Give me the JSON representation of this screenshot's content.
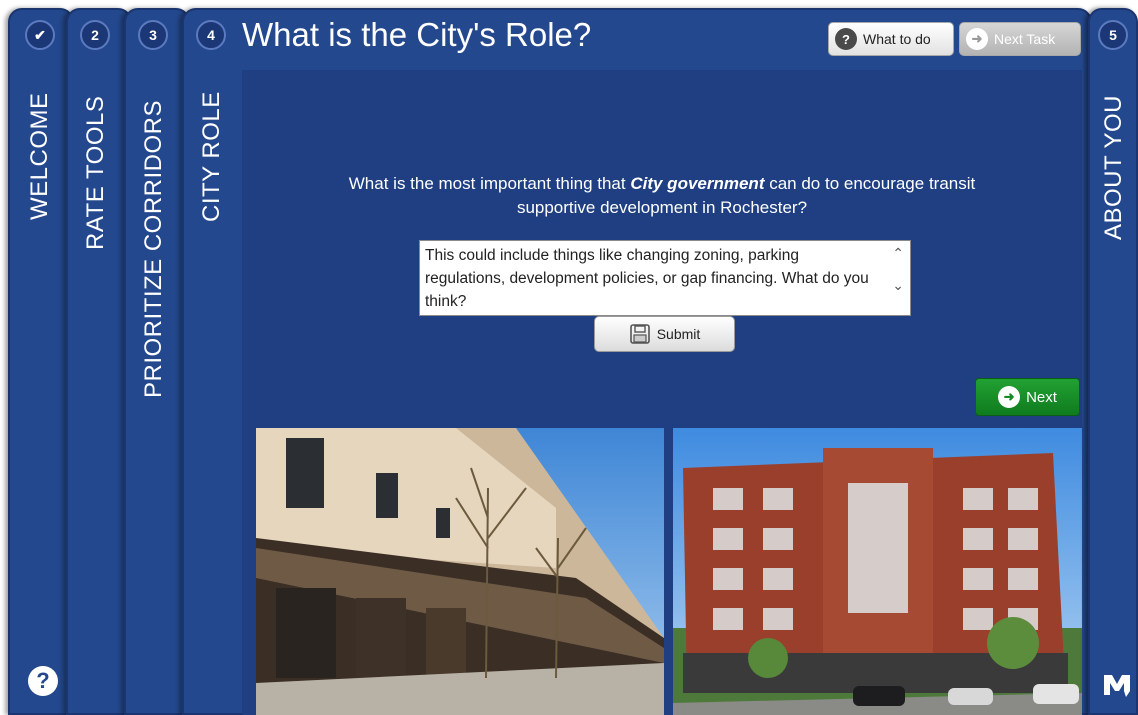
{
  "tabs": [
    {
      "number": "✔",
      "label": "WELCOME"
    },
    {
      "number": "2",
      "label": "RATE TOOLS"
    },
    {
      "number": "3",
      "label": "PRIORITIZE CORRIDORS"
    },
    {
      "number": "4",
      "label": "CITY ROLE"
    },
    {
      "number": "5",
      "label": "ABOUT YOU"
    }
  ],
  "header": {
    "title": "What is the City's Role?",
    "what_to_do_label": "What to do",
    "next_task_label": "Next Task"
  },
  "question": {
    "prefix": "What is the most important thing that ",
    "emphasis": "City government",
    "suffix_line1": " can do to encourage transit",
    "line2": "supportive development in Rochester?"
  },
  "response": {
    "text": "This could include things like changing zoning, parking regulations, development policies, or gap financing. What do you think?"
  },
  "buttons": {
    "submit_label": "Submit",
    "next_label": "Next"
  },
  "help": {
    "symbol": "?"
  },
  "colors": {
    "panel_blue": "#24488d",
    "content_blue": "#1f3f82",
    "next_green": "#1a9129"
  },
  "icons": [
    "check-icon",
    "help-icon",
    "arrow-right-icon",
    "save-icon",
    "scroll-up-icon",
    "scroll-down-icon",
    "m-logo-icon"
  ]
}
